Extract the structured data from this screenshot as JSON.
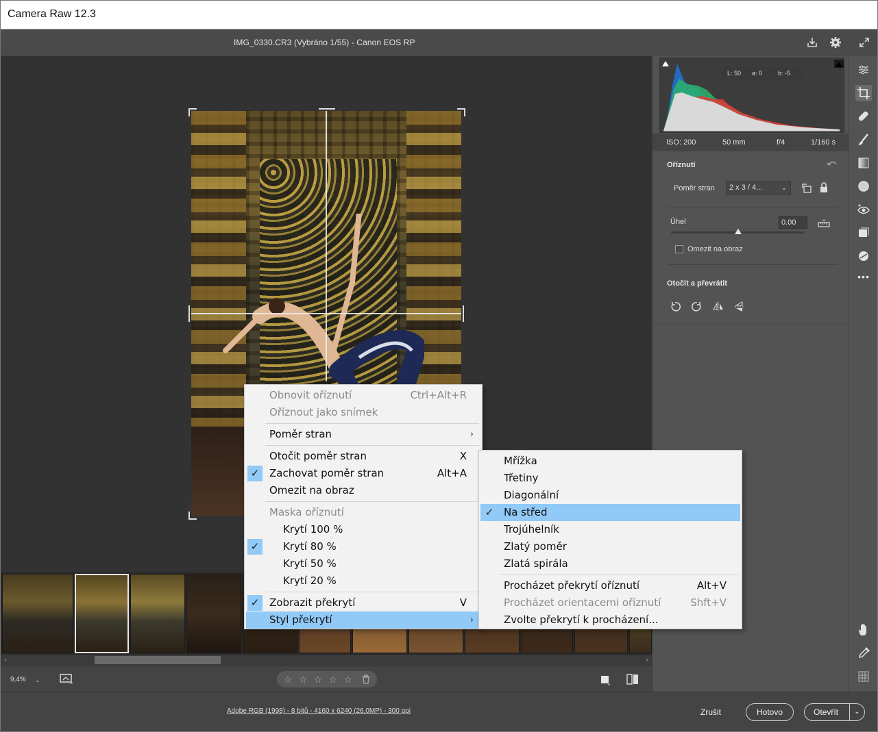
{
  "window": {
    "title": "Camera Raw 12.3"
  },
  "header": {
    "file_info": "IMG_0330.CR3  (Vybráno 1/55)  -  Canon EOS RP"
  },
  "histogram": {
    "lab": {
      "l": "L: 50",
      "a": "a: 0",
      "b": "b: -5"
    },
    "iso": "ISO: 200",
    "focal": "50 mm",
    "aperture": "f/4",
    "shutter": "1/160 s"
  },
  "crop_panel": {
    "title": "Oříznutí",
    "aspect_label": "Poměr stran",
    "aspect_value": "2 x 3  / 4...",
    "angle_label": "Úhel",
    "angle_value": "0.00",
    "angle_slider_fraction": 0.5,
    "constrain_label": "Omezit na obraz",
    "rotate_title": "Otočit a převrátit"
  },
  "context_menu": {
    "items": [
      {
        "label": "Obnovit oříznutí",
        "shortcut": "Ctrl+Alt+R",
        "disabled": true,
        "checked": false
      },
      {
        "label": "Oříznout jako snímek",
        "shortcut": "",
        "disabled": true,
        "checked": false
      },
      {
        "label": "Poměr stran",
        "shortcut": "",
        "submenu": true
      },
      {
        "label": "Otočit poměr stran",
        "shortcut": "X"
      },
      {
        "label": "Zachovat poměr stran",
        "shortcut": "Alt+A",
        "checked": true
      },
      {
        "label": "Omezit na obraz",
        "shortcut": ""
      },
      {
        "label": "Maska oříznutí",
        "disabled": true
      },
      {
        "label": "Krytí 100 %"
      },
      {
        "label": "Krytí 80 %",
        "checked": true
      },
      {
        "label": "Krytí 50 %"
      },
      {
        "label": "Krytí 20 %"
      },
      {
        "label": "Zobrazit překrytí",
        "shortcut": "V",
        "checked": true
      },
      {
        "label": "Styl překrytí",
        "submenu": true,
        "highlighted": true
      }
    ]
  },
  "submenu": {
    "items": [
      {
        "label": "Mřížka"
      },
      {
        "label": "Třetiny"
      },
      {
        "label": "Diagonální"
      },
      {
        "label": "Na střed",
        "checked": true,
        "highlighted": true
      },
      {
        "label": "Trojúhelník"
      },
      {
        "label": "Zlatý poměr"
      },
      {
        "label": "Zlatá spirála"
      },
      {
        "label": "Procházet překrytí oříznutí",
        "shortcut": "Alt+V"
      },
      {
        "label": "Procházet orientacemi oříznutí",
        "shortcut": "Shft+V",
        "disabled": true
      },
      {
        "label": "Zvolte překrytí k procházení..."
      }
    ]
  },
  "toolbar": {
    "zoom": "9,4%"
  },
  "footer": {
    "info_link": "Adobe RGB (1998) - 8 bitů - 4160 x 6240 (26,0MP) - 300 ppi",
    "cancel": "Zrušit",
    "done": "Hotovo",
    "open": "Otevřít"
  },
  "icons": {
    "accent_highlight": "#91c9f7",
    "canvas_bg": "#323232",
    "panel_bg": "#535353"
  }
}
